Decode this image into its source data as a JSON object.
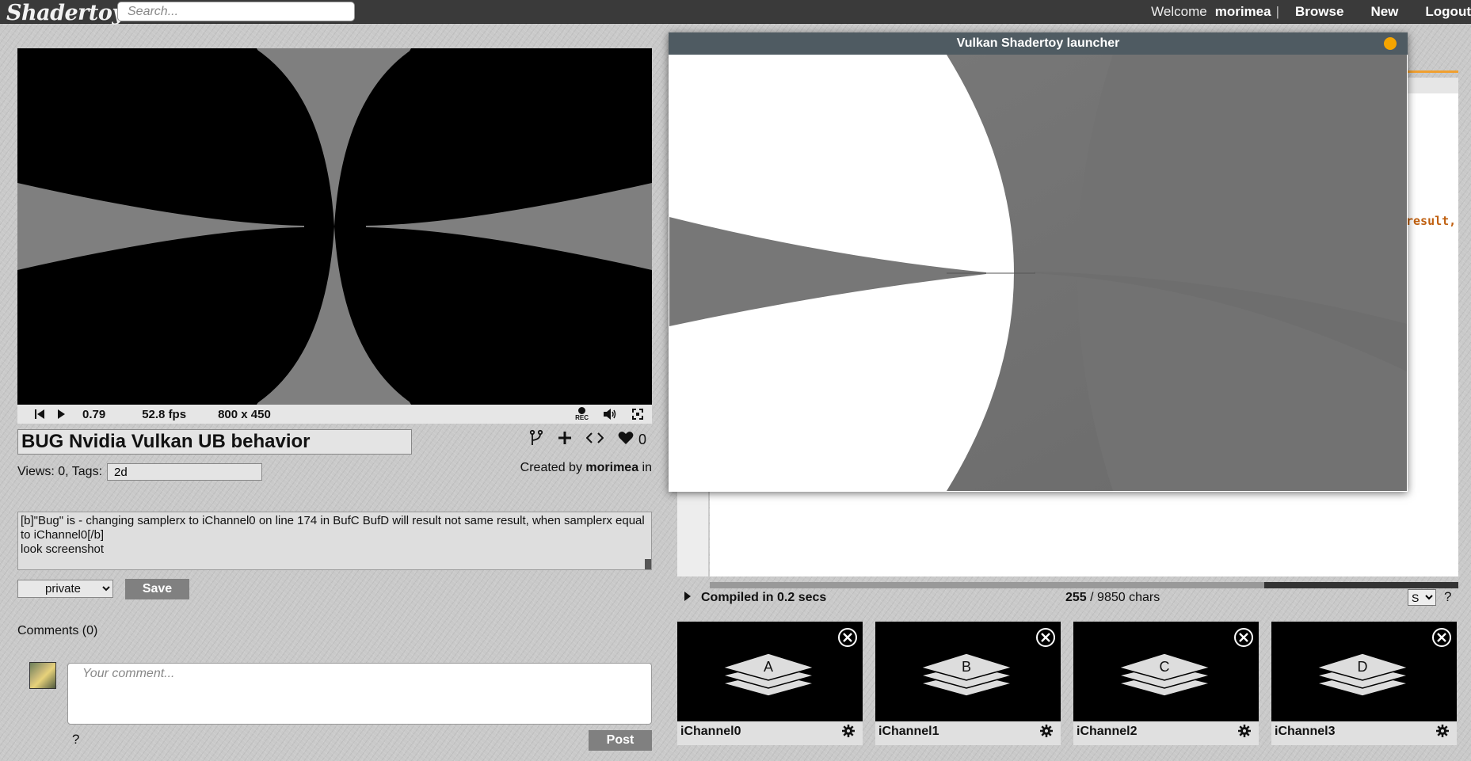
{
  "header": {
    "logo": "Shadertoy",
    "search_placeholder": "Search...",
    "welcome": "Welcome",
    "username": "morimea",
    "separator": "|",
    "nav": [
      "Browse",
      "New",
      "Logout"
    ]
  },
  "player": {
    "time": "0.79",
    "fps": "52.8 fps",
    "resolution": "800 x 450",
    "rec_label": "REC"
  },
  "shader": {
    "title": "BUG Nvidia Vulkan UB behavior",
    "likes": "0",
    "views_label": "Views: 0, Tags:",
    "tags": "2d",
    "created_by_label": "Created by",
    "author": "morimea",
    "in_label": "in",
    "description": "[b]\"Bug\" is - changing samplerx to iChannel0 on line 174 in BufC BufD will result not same result, when samplerx equal to iChannel0[/b]\nlook screenshot",
    "privacy": "private",
    "privacy_options": [
      "private"
    ],
    "save_label": "Save"
  },
  "comments": {
    "label": "Comments (0)",
    "placeholder": "Your comment...",
    "help": "?",
    "post_label": "Post"
  },
  "editor": {
    "code_fragment": "result,",
    "compile_status": "Compiled in 0.2 secs",
    "chars_used": "255",
    "chars_total": " / 9850 chars",
    "font_size": "S",
    "help": "?"
  },
  "channels": [
    {
      "label": "iChannel0",
      "buffer": "A"
    },
    {
      "label": "iChannel1",
      "buffer": "B"
    },
    {
      "label": "iChannel2",
      "buffer": "C"
    },
    {
      "label": "iChannel3",
      "buffer": "D"
    }
  ],
  "popup": {
    "title": "Vulkan Shadertoy launcher"
  },
  "colors": {
    "topbar": "#3a3a3a",
    "accent": "#f0a030",
    "popup_close": "#f5a500",
    "button_gray": "#808080"
  }
}
